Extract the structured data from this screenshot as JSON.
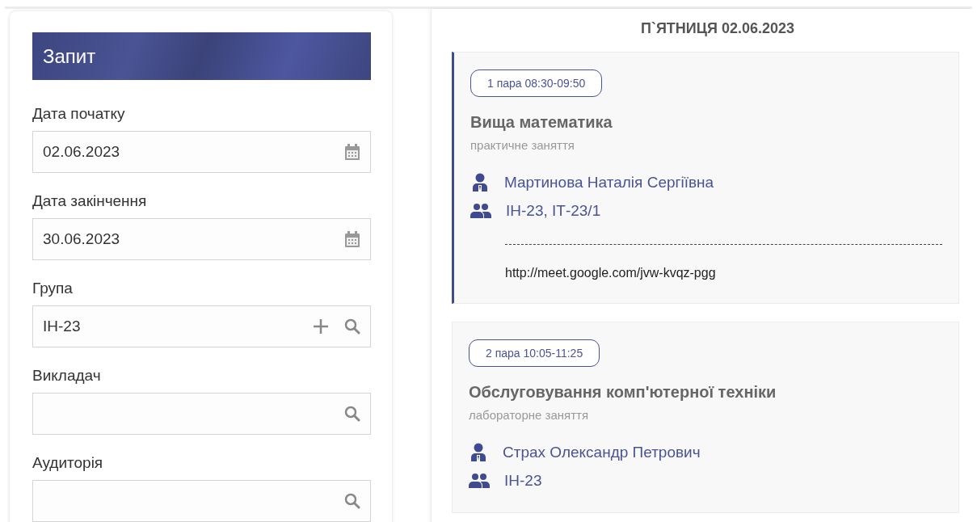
{
  "query_panel": {
    "title": "Запит",
    "fields": [
      {
        "label": "Дата початку",
        "value": "02.06.2023",
        "icons": [
          {
            "kind": "calendar"
          }
        ]
      },
      {
        "label": "Дата закінчення",
        "value": "30.06.2023",
        "icons": [
          {
            "kind": "calendar"
          }
        ]
      },
      {
        "label": "Група",
        "value": "ІН-23",
        "icons": [
          {
            "kind": "add"
          },
          {
            "kind": "search"
          }
        ]
      },
      {
        "label": "Викладач",
        "icons": [
          {
            "kind": "search"
          }
        ]
      },
      {
        "label": "Аудиторія",
        "icons": [
          {
            "kind": "search"
          }
        ]
      }
    ]
  },
  "schedule": {
    "day_title": "П`ЯТНИЦЯ 02.06.2023",
    "lessons": [
      {
        "highlighted": true,
        "time_badge": "1 пара 08:30-09:50",
        "subject": "Вища математика",
        "type": "практичне заняття",
        "teacher": "Мартинова Наталія Сергіївна",
        "groups": "ІН-23, ІТ-23/1",
        "link": "http://meet.google.com/jvw-kvqz-pgg"
      },
      {
        "highlighted": false,
        "time_badge": "2 пара 10:05-11:25",
        "subject": "Обслуговування комп'ютерної техніки",
        "type": "лабораторне заняття",
        "teacher": "Страх Олександр Петрович",
        "groups": "ІН-23"
      }
    ]
  }
}
